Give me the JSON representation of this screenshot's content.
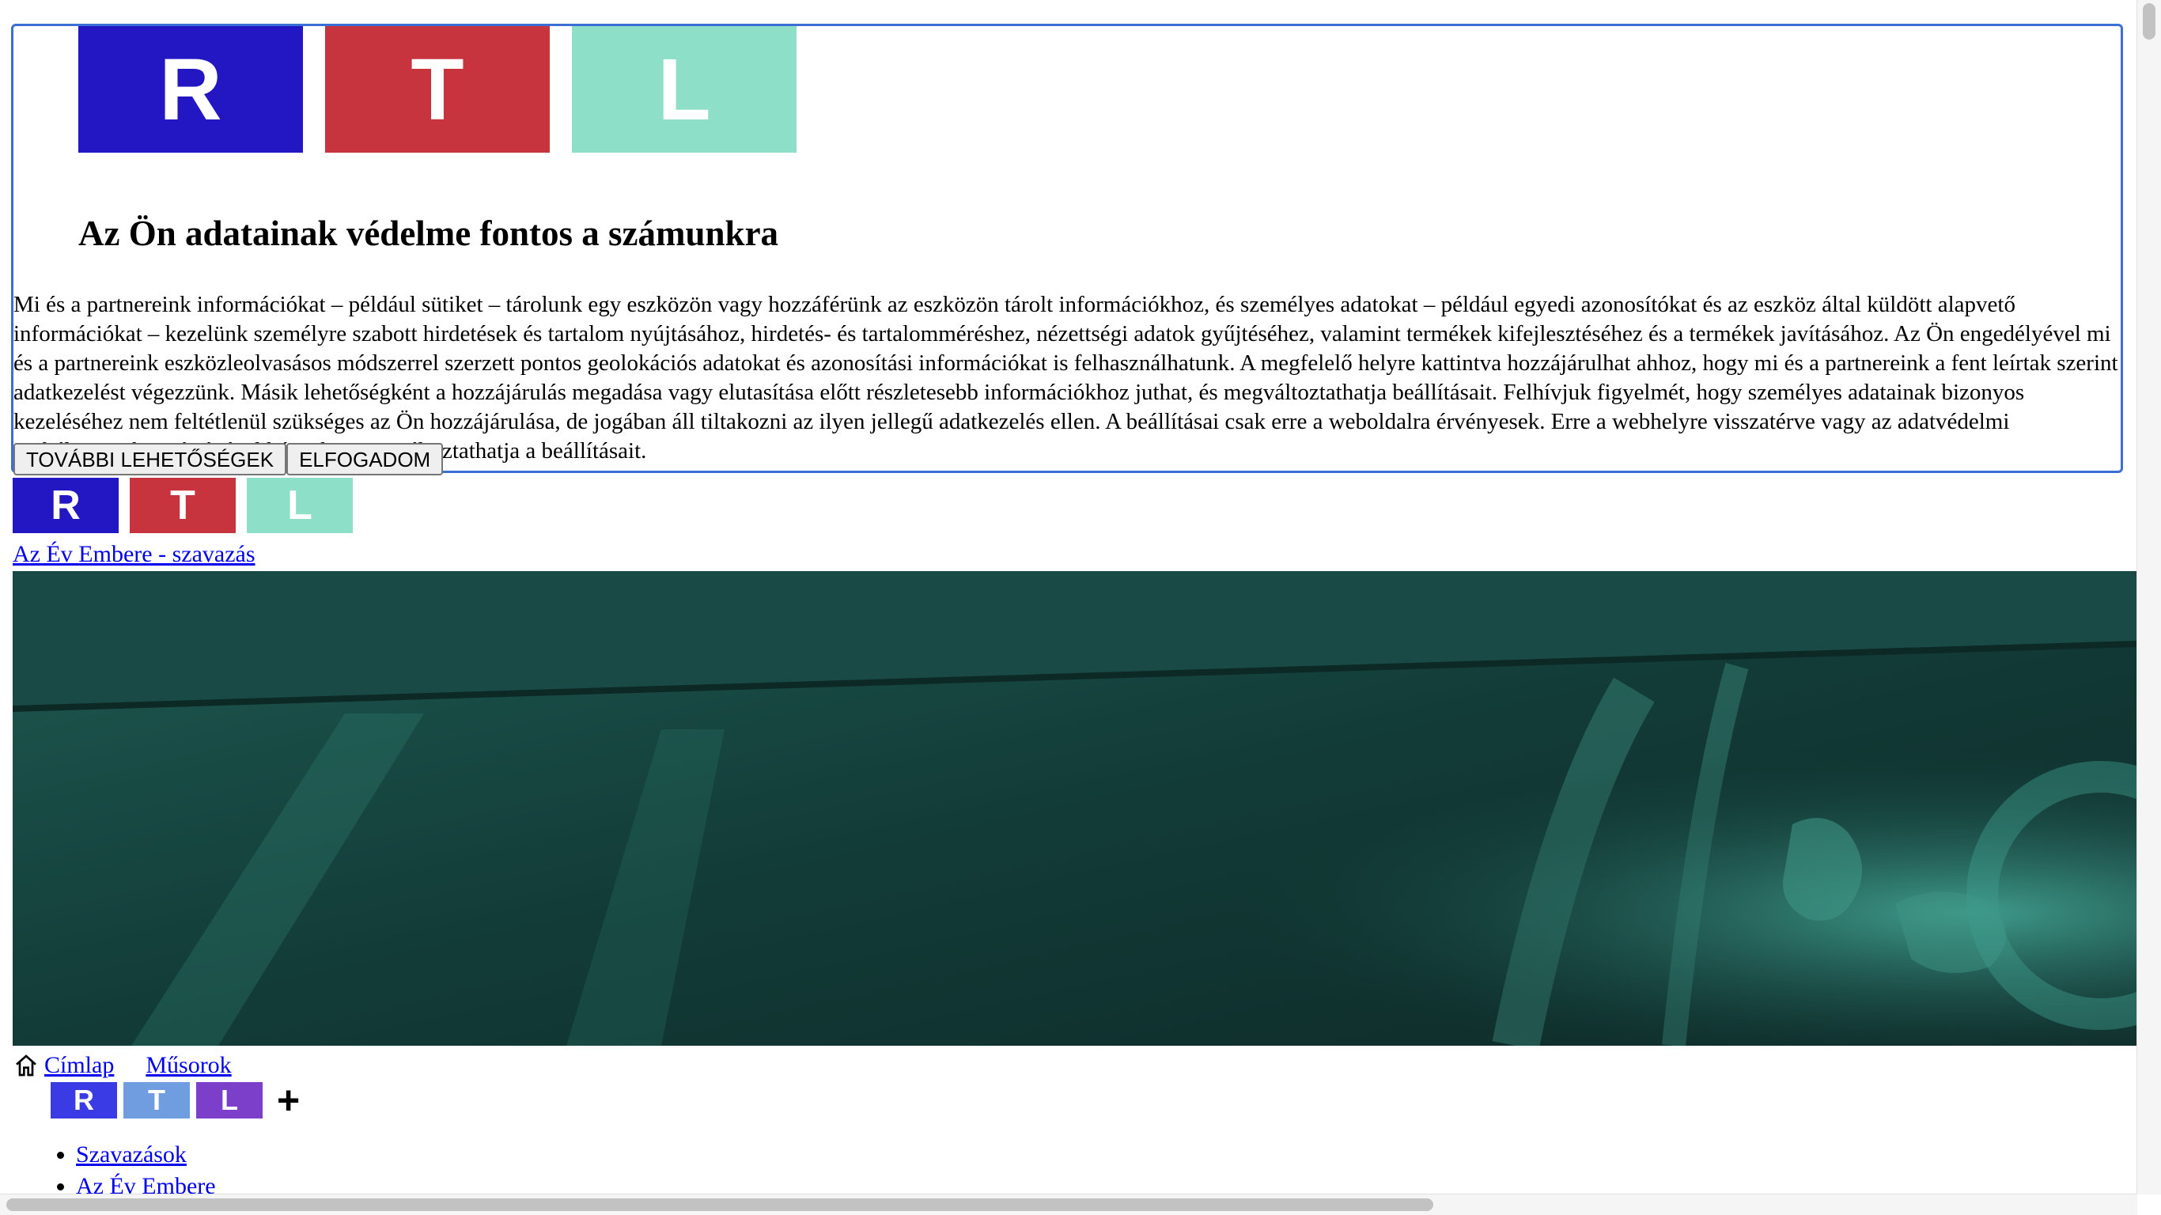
{
  "consent": {
    "logo_letters": [
      "R",
      "T",
      "L"
    ],
    "logo_colors": [
      "#2317c4",
      "#c7343e",
      "#8de0c7"
    ],
    "heading": "Az Ön adatainak védelme fontos a számunkra",
    "body": "Mi és a partnereink információkat – például sütiket – tárolunk egy eszközön vagy hozzáférünk az eszközön tárolt információkhoz, és személyes adatokat – például egyedi azonosítókat és az eszköz által küldött alapvető információkat – kezelünk személyre szabott hirdetések és tartalom nyújtásához, hirdetés- és tartalomméréshez, nézettségi adatok gyűjtéséhez, valamint termékek kifejlesztéséhez és a termékek javításához. Az Ön engedélyével mi és a partnereink eszközleolvasásos módszerrel szerzett pontos geolokációs adatokat és azonosítási információkat is felhasználhatunk. A megfelelő helyre kattintva hozzájárulhat ahhoz, hogy mi és a partnereink a fent leírtak szerint adatkezelést végezzünk. Másik lehetőségként a hozzájárulás megadása vagy elutasítása előtt részletesebb információkhoz juthat, és megváltoztathatja beállításait. Felhívjuk figyelmét, hogy személyes adatainak bizonyos kezeléséhez nem feltétlenül szükséges az Ön hozzájárulása, de jogában áll tiltakozni az ilyen jellegű adatkezelés ellen. A beállításai csak erre a weboldalra érvényesek. Erre a webhelyre visszatérve vagy az adatvédelmi szabályzatunk segítségével bármikor megváltoztathatja a beállításait.",
    "more_options_label": "TOVÁBBI LEHETŐSÉGEK",
    "accept_label": "ELFOGADOM"
  },
  "site": {
    "logo_letters": [
      "R",
      "T",
      "L"
    ],
    "vote_link": "Az Év Embere - szavazás"
  },
  "nav": {
    "home_icon": "home-icon",
    "home_label": "Címlap",
    "shows_label": "Műsorok"
  },
  "rtlplus": {
    "letters": [
      "R",
      "T",
      "L"
    ],
    "colors": [
      "#3b3be6",
      "#6f9de0",
      "#7b3fc9"
    ],
    "plus": "+"
  },
  "menu": {
    "items": [
      "Szavazások",
      "Az Év Embere"
    ]
  }
}
